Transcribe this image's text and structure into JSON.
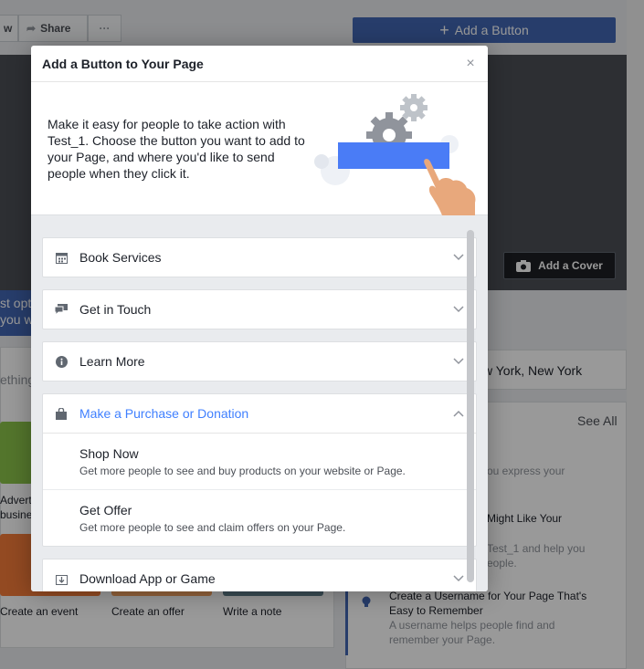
{
  "background": {
    "top_partial_label": "w",
    "share_label": "Share",
    "more_label": "···",
    "add_button_label": "Add a Button",
    "add_cover_label": "Add a Cover",
    "blue_card_lines": [
      "st opti",
      "you w"
    ],
    "search_partial": "ething",
    "location_label": "w York, New York",
    "see_all_label": "See All",
    "left_tiles": [
      {
        "label": "Advert",
        "label2": "busine"
      },
      {
        "label": "Create an event"
      },
      {
        "label": "Create an offer"
      },
      {
        "label": "Write a note"
      }
    ],
    "right_items": [
      {
        "text": "ou express your"
      },
      {
        "text": "Might Like Your"
      },
      {
        "text": "Test_1 and help you"
      },
      {
        "text": "eople."
      },
      {
        "title": "Create a Username for Your Page That's Easy to Remember",
        "desc": "A username helps people find and remember your Page."
      }
    ]
  },
  "dialog": {
    "title": "Add a Button to Your Page",
    "close_symbol": "×",
    "intro": "Make it easy for people to take action with Test_1. Choose the button you want to add to your Page, and where you'd like to send people when they click it.",
    "categories": [
      {
        "label": "Book Services",
        "icon": "calendar-icon",
        "expanded": false
      },
      {
        "label": "Get in Touch",
        "icon": "chat-icon",
        "expanded": false
      },
      {
        "label": "Learn More",
        "icon": "info-icon",
        "expanded": false
      },
      {
        "label": "Make a Purchase or Donation",
        "icon": "shopping-bag-icon",
        "expanded": true,
        "options": [
          {
            "title": "Shop Now",
            "desc": "Get more people to see and buy products on your website or Page."
          },
          {
            "title": "Get Offer",
            "desc": "Get more people to see and claim offers on your Page."
          }
        ]
      },
      {
        "label": "Download App or Game",
        "icon": "download-icon",
        "expanded": false
      }
    ]
  },
  "colors": {
    "accent": "#4080ff",
    "brand_blue": "#4267b2",
    "illustration_blue": "#4a7cf6"
  }
}
